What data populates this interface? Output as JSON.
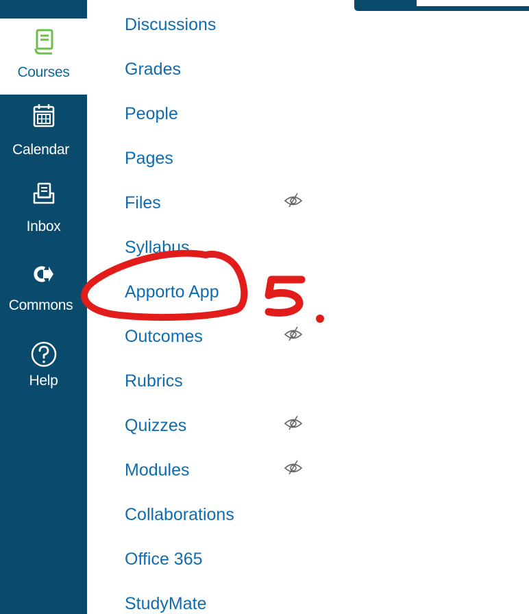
{
  "global_nav": {
    "items": [
      {
        "label": "Courses",
        "icon": "courses-book-icon",
        "active": true
      },
      {
        "label": "Calendar",
        "icon": "calendar-icon"
      },
      {
        "label": "Inbox",
        "icon": "inbox-icon"
      },
      {
        "label": "Commons",
        "icon": "commons-share-icon"
      },
      {
        "label": "Help",
        "icon": "help-question-icon"
      }
    ],
    "colors": {
      "background": "#0a4a6d",
      "active_bg": "#ffffff",
      "active_icon": "#6dbf4b",
      "active_text": "#0a6aa0"
    }
  },
  "course_nav": {
    "link_color": "#0f6cb0",
    "items": [
      {
        "label": "Discussions",
        "hidden_from_students": false
      },
      {
        "label": "Grades",
        "hidden_from_students": false
      },
      {
        "label": "People",
        "hidden_from_students": false
      },
      {
        "label": "Pages",
        "hidden_from_students": false
      },
      {
        "label": "Files",
        "hidden_from_students": true
      },
      {
        "label": "Syllabus",
        "hidden_from_students": false
      },
      {
        "label": "Apporto App",
        "hidden_from_students": false
      },
      {
        "label": "Outcomes",
        "hidden_from_students": true
      },
      {
        "label": "Rubrics",
        "hidden_from_students": false
      },
      {
        "label": "Quizzes",
        "hidden_from_students": true
      },
      {
        "label": "Modules",
        "hidden_from_students": true
      },
      {
        "label": "Collaborations",
        "hidden_from_students": false
      },
      {
        "label": "Office 365",
        "hidden_from_students": false
      },
      {
        "label": "StudyMate",
        "hidden_from_students": false
      }
    ]
  },
  "annotation": {
    "text": "5.",
    "color": "#e21b1b",
    "icon": "red-circle-markup"
  }
}
